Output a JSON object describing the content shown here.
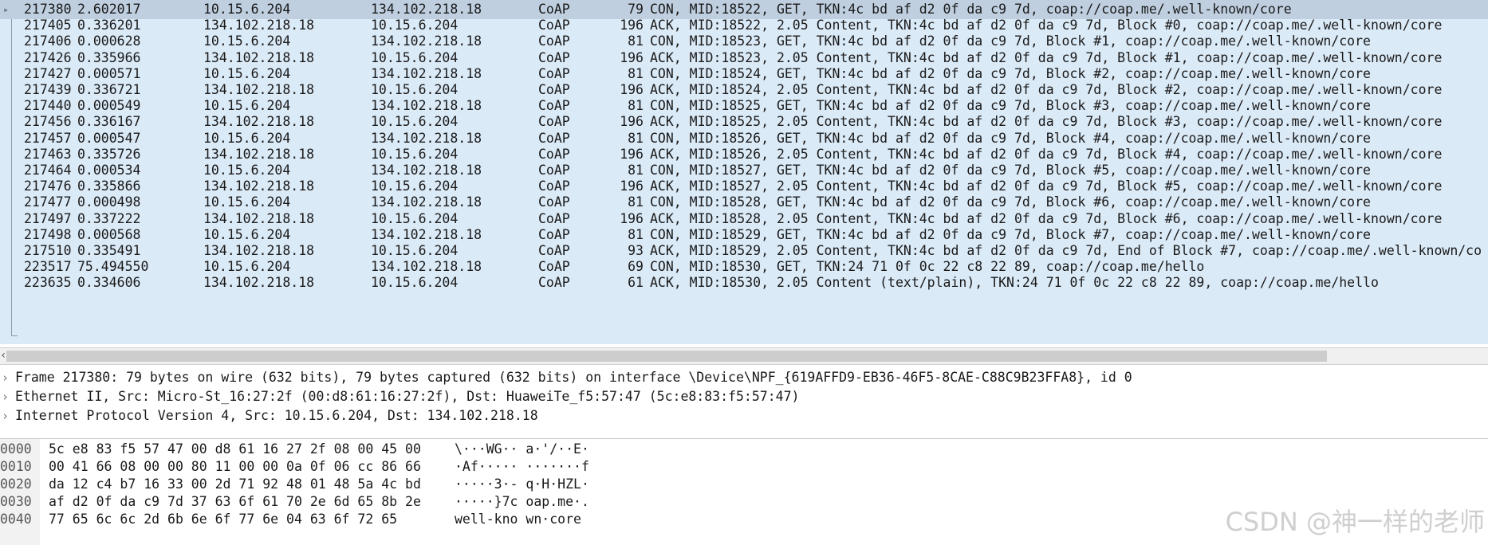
{
  "packets": [
    {
      "no": "217380",
      "time": "2.602017",
      "src": "10.15.6.204",
      "dst": "134.102.218.18",
      "proto": "CoAP",
      "len": "79",
      "info": "CON, MID:18522, GET, TKN:4c bd af d2 0f da c9 7d, coap://coap.me/.well-known/core",
      "selected": true
    },
    {
      "no": "217405",
      "time": "0.336201",
      "src": "134.102.218.18",
      "dst": "10.15.6.204",
      "proto": "CoAP",
      "len": "196",
      "info": "ACK, MID:18522, 2.05 Content, TKN:4c bd af d2 0f da c9 7d, Block #0, coap://coap.me/.well-known/core"
    },
    {
      "no": "217406",
      "time": "0.000628",
      "src": "10.15.6.204",
      "dst": "134.102.218.18",
      "proto": "CoAP",
      "len": "81",
      "info": "CON, MID:18523, GET, TKN:4c bd af d2 0f da c9 7d, Block #1, coap://coap.me/.well-known/core"
    },
    {
      "no": "217426",
      "time": "0.335966",
      "src": "134.102.218.18",
      "dst": "10.15.6.204",
      "proto": "CoAP",
      "len": "196",
      "info": "ACK, MID:18523, 2.05 Content, TKN:4c bd af d2 0f da c9 7d, Block #1, coap://coap.me/.well-known/core"
    },
    {
      "no": "217427",
      "time": "0.000571",
      "src": "10.15.6.204",
      "dst": "134.102.218.18",
      "proto": "CoAP",
      "len": "81",
      "info": "CON, MID:18524, GET, TKN:4c bd af d2 0f da c9 7d, Block #2, coap://coap.me/.well-known/core"
    },
    {
      "no": "217439",
      "time": "0.336721",
      "src": "134.102.218.18",
      "dst": "10.15.6.204",
      "proto": "CoAP",
      "len": "196",
      "info": "ACK, MID:18524, 2.05 Content, TKN:4c bd af d2 0f da c9 7d, Block #2, coap://coap.me/.well-known/core"
    },
    {
      "no": "217440",
      "time": "0.000549",
      "src": "10.15.6.204",
      "dst": "134.102.218.18",
      "proto": "CoAP",
      "len": "81",
      "info": "CON, MID:18525, GET, TKN:4c bd af d2 0f da c9 7d, Block #3, coap://coap.me/.well-known/core"
    },
    {
      "no": "217456",
      "time": "0.336167",
      "src": "134.102.218.18",
      "dst": "10.15.6.204",
      "proto": "CoAP",
      "len": "196",
      "info": "ACK, MID:18525, 2.05 Content, TKN:4c bd af d2 0f da c9 7d, Block #3, coap://coap.me/.well-known/core"
    },
    {
      "no": "217457",
      "time": "0.000547",
      "src": "10.15.6.204",
      "dst": "134.102.218.18",
      "proto": "CoAP",
      "len": "81",
      "info": "CON, MID:18526, GET, TKN:4c bd af d2 0f da c9 7d, Block #4, coap://coap.me/.well-known/core"
    },
    {
      "no": "217463",
      "time": "0.335726",
      "src": "134.102.218.18",
      "dst": "10.15.6.204",
      "proto": "CoAP",
      "len": "196",
      "info": "ACK, MID:18526, 2.05 Content, TKN:4c bd af d2 0f da c9 7d, Block #4, coap://coap.me/.well-known/core"
    },
    {
      "no": "217464",
      "time": "0.000534",
      "src": "10.15.6.204",
      "dst": "134.102.218.18",
      "proto": "CoAP",
      "len": "81",
      "info": "CON, MID:18527, GET, TKN:4c bd af d2 0f da c9 7d, Block #5, coap://coap.me/.well-known/core"
    },
    {
      "no": "217476",
      "time": "0.335866",
      "src": "134.102.218.18",
      "dst": "10.15.6.204",
      "proto": "CoAP",
      "len": "196",
      "info": "ACK, MID:18527, 2.05 Content, TKN:4c bd af d2 0f da c9 7d, Block #5, coap://coap.me/.well-known/core"
    },
    {
      "no": "217477",
      "time": "0.000498",
      "src": "10.15.6.204",
      "dst": "134.102.218.18",
      "proto": "CoAP",
      "len": "81",
      "info": "CON, MID:18528, GET, TKN:4c bd af d2 0f da c9 7d, Block #6, coap://coap.me/.well-known/core"
    },
    {
      "no": "217497",
      "time": "0.337222",
      "src": "134.102.218.18",
      "dst": "10.15.6.204",
      "proto": "CoAP",
      "len": "196",
      "info": "ACK, MID:18528, 2.05 Content, TKN:4c bd af d2 0f da c9 7d, Block #6, coap://coap.me/.well-known/core"
    },
    {
      "no": "217498",
      "time": "0.000568",
      "src": "10.15.6.204",
      "dst": "134.102.218.18",
      "proto": "CoAP",
      "len": "81",
      "info": "CON, MID:18529, GET, TKN:4c bd af d2 0f da c9 7d, Block #7, coap://coap.me/.well-known/core"
    },
    {
      "no": "217510",
      "time": "0.335491",
      "src": "134.102.218.18",
      "dst": "10.15.6.204",
      "proto": "CoAP",
      "len": "93",
      "info": "ACK, MID:18529, 2.05 Content, TKN:4c bd af d2 0f da c9 7d, End of Block #7, coap://coap.me/.well-known/co"
    },
    {
      "no": "223517",
      "time": "75.494550",
      "src": "10.15.6.204",
      "dst": "134.102.218.18",
      "proto": "CoAP",
      "len": "69",
      "info": "CON, MID:18530, GET, TKN:24 71 0f 0c 22 c8 22 89, coap://coap.me/hello"
    },
    {
      "no": "223635",
      "time": "0.334606",
      "src": "134.102.218.18",
      "dst": "10.15.6.204",
      "proto": "CoAP",
      "len": "61",
      "info": "ACK, MID:18530, 2.05 Content (text/plain), TKN:24 71 0f 0c 22 c8 22 89, coap://coap.me/hello"
    }
  ],
  "details": [
    "Frame 217380: 79 bytes on wire (632 bits), 79 bytes captured (632 bits) on interface \\Device\\NPF_{619AFFD9-EB36-46F5-8CAE-C88C9B23FFA8}, id 0",
    "Ethernet II, Src: Micro-St_16:27:2f (00:d8:61:16:27:2f), Dst: HuaweiTe_f5:57:47 (5c:e8:83:f5:57:47)",
    "Internet Protocol Version 4, Src: 10.15.6.204, Dst: 134.102.218.18"
  ],
  "bytes": [
    {
      "offset": "0000",
      "hex": "5c e8 83 f5 57 47 00 d8  61 16 27 2f 08 00 45 00",
      "ascii": "\\···WG·· a·'/··E·"
    },
    {
      "offset": "0010",
      "hex": "00 41 66 08 00 00 80 11  00 00 0a 0f 06 cc 86 66",
      "ascii": "·Af····· ·······f"
    },
    {
      "offset": "0020",
      "hex": "da 12 c4 b7 16 33 00 2d  71 92 48 01 48 5a 4c bd",
      "ascii": "·····3·- q·H·HZL·"
    },
    {
      "offset": "0030",
      "hex": "af d2 0f da c9 7d 37 63  6f 61 70 2e 6d 65 8b 2e",
      "ascii": "·····}7c oap.me·."
    },
    {
      "offset": "0040",
      "hex": "77 65 6c 6c 2d 6b 6e 6f  77 6e 04 63 6f 72 65",
      "ascii": "well-kno wn·core"
    }
  ],
  "watermark": "CSDN @神一样的老师",
  "colors": {
    "list_bg": "#dbeaf7",
    "selected_bg": "#bfcfe0",
    "gutter": "#f2f2f2"
  },
  "icons": {
    "expand": "chevron-right-icon",
    "selected": "selected-row-arrow-icon"
  }
}
